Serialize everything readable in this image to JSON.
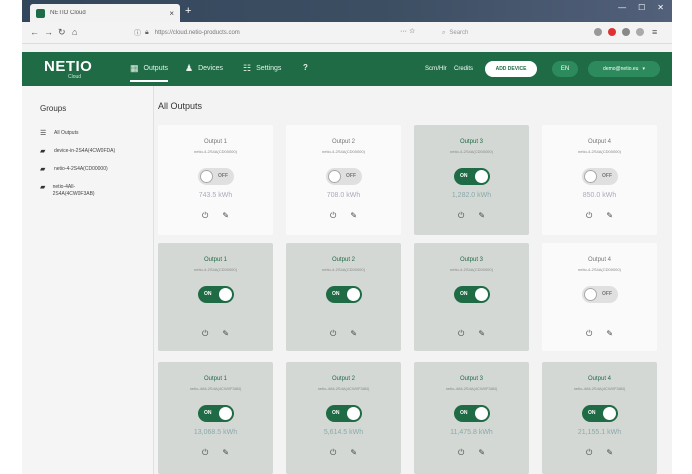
{
  "browser": {
    "tab_title": "NETIO Cloud",
    "url": "https://cloud.netio-products.com",
    "search_placeholder": "Search"
  },
  "header": {
    "logo": "NETIO",
    "logo_sub": "Cloud",
    "nav": [
      "Outputs",
      "Devices",
      "Settings"
    ],
    "help": "?",
    "link_1": "Scrn/Hlr",
    "link_2": "Credits",
    "add_device": "ADD DEVICE",
    "lang": "EN",
    "user": "demo@netio.eu"
  },
  "sidebar": {
    "title": "Groups",
    "items": [
      {
        "label": "All Outputs",
        "icon": "list-icon"
      },
      {
        "label": "device-in-2S4A(4CW0FDA)",
        "icon": "folder-icon"
      },
      {
        "label": "netio-4-2S4A(CD00000)",
        "icon": "folder-icon"
      },
      {
        "label": "netio-4All-2S4A(4CW0F3AB)",
        "icon": "folder-icon"
      }
    ]
  },
  "main": {
    "title": "All Outputs",
    "cards": [
      {
        "title": "Output 1",
        "sub": "netio-4-2S4A(CD00000)",
        "state": "OFF",
        "energy": "743.5 kWh",
        "on": false
      },
      {
        "title": "Output 2",
        "sub": "netio-4-2S4A(CD00000)",
        "state": "OFF",
        "energy": "708.0 kWh",
        "on": false
      },
      {
        "title": "Output 3",
        "sub": "netio-4-2S4A(CD00000)",
        "state": "ON",
        "energy": "1,282.0 kWh",
        "on": true
      },
      {
        "title": "Output 4",
        "sub": "netio-4-2S4A(CD00000)",
        "state": "OFF",
        "energy": "850.0 kWh",
        "on": false
      },
      {
        "title": "Output 1",
        "sub": "netio-4-2S4A(CD00000)",
        "state": "ON",
        "energy": "",
        "on": true
      },
      {
        "title": "Output 2",
        "sub": "netio-4-2S4A(CD00000)",
        "state": "ON",
        "energy": "",
        "on": true
      },
      {
        "title": "Output 3",
        "sub": "netio-4-2S4A(CD00000)",
        "state": "ON",
        "energy": "",
        "on": true
      },
      {
        "title": "Output 4",
        "sub": "netio-4-2S4A(CD00000)",
        "state": "OFF",
        "energy": "",
        "on": false
      },
      {
        "title": "Output 1",
        "sub": "netio-4All-2S4A(4CW0F3AB)",
        "state": "ON",
        "energy": "13,068.5 kWh",
        "on": true
      },
      {
        "title": "Output 2",
        "sub": "netio-4All-2S4A(4CW0F3AB)",
        "state": "ON",
        "energy": "5,614.5 kWh",
        "on": true
      },
      {
        "title": "Output 3",
        "sub": "netio-4All-2S4A(4CW0F3AB)",
        "state": "ON",
        "energy": "11,475.8 kWh",
        "on": true
      },
      {
        "title": "Output 4",
        "sub": "netio-4All-2S4A(4CW0F3AB)",
        "state": "ON",
        "energy": "21,155.1 kWh",
        "on": true
      }
    ]
  },
  "colors": {
    "brand": "#1e6b45",
    "card_on": "#d4d8d4",
    "card_off": "#fafafa"
  }
}
